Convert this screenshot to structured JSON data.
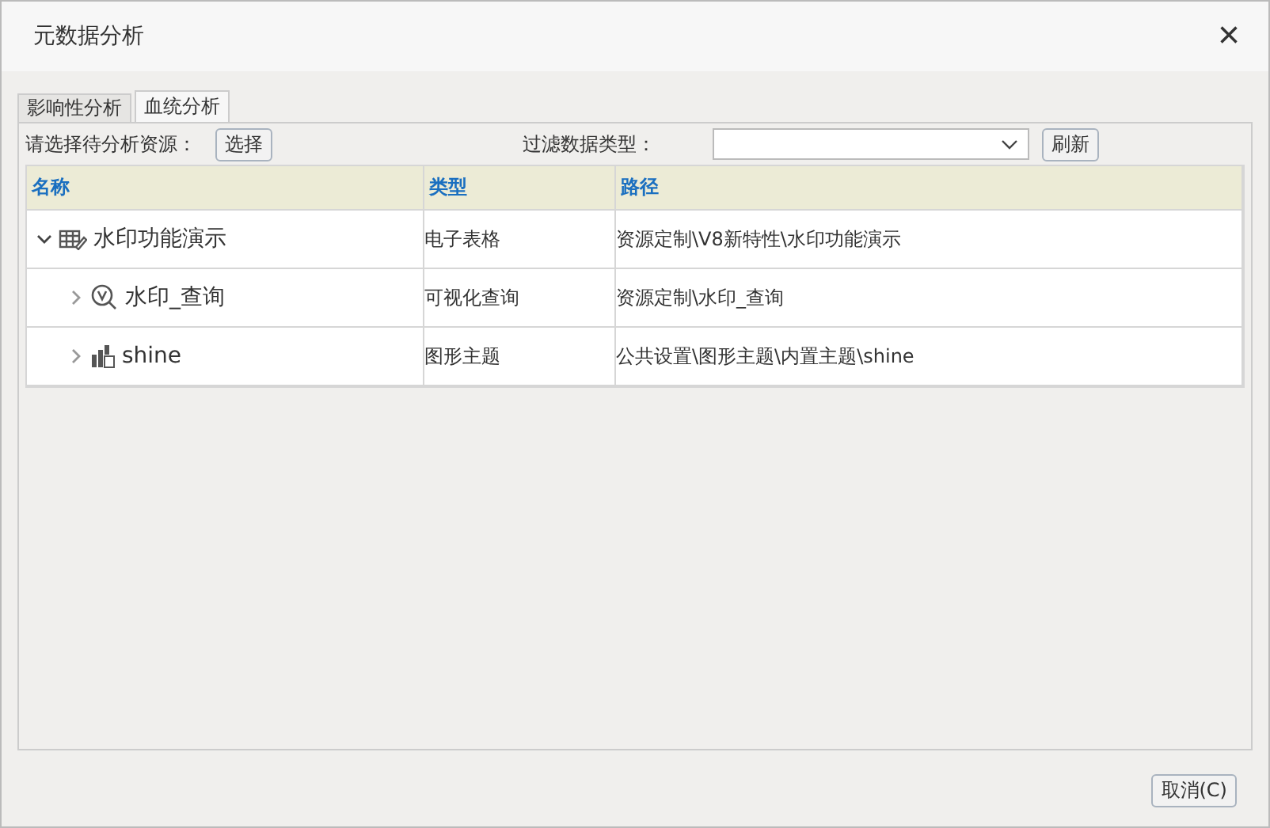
{
  "window": {
    "title": "元数据分析",
    "close": "×"
  },
  "tabs": [
    {
      "label": "影响性分析",
      "selected": false
    },
    {
      "label": "血统分析",
      "selected": true
    }
  ],
  "toolbar": {
    "resource_label": "请选择待分析资源：",
    "select_button": "选择",
    "filter_label": "过滤数据类型：",
    "refresh_button": "刷新"
  },
  "table": {
    "columns": [
      "名称",
      "类型",
      "路径"
    ],
    "rows": [
      {
        "name": "水印功能演示",
        "kind": "spreadsheet",
        "expanded": true,
        "type": "电子表格",
        "path": "资源定制\\V8新特性\\水印功能演示",
        "children": [
          {
            "name": "水印_查询",
            "kind": "query",
            "expanded": false,
            "type": "可视化查询",
            "path": "资源定制\\水印_查询"
          },
          {
            "name": "shine",
            "kind": "theme",
            "expanded": false,
            "type": "图形主题",
            "path": "公共设置\\图形主题\\内置主题\\shine"
          }
        ]
      }
    ]
  },
  "footer": {
    "cancel_button": "取消(C)"
  }
}
